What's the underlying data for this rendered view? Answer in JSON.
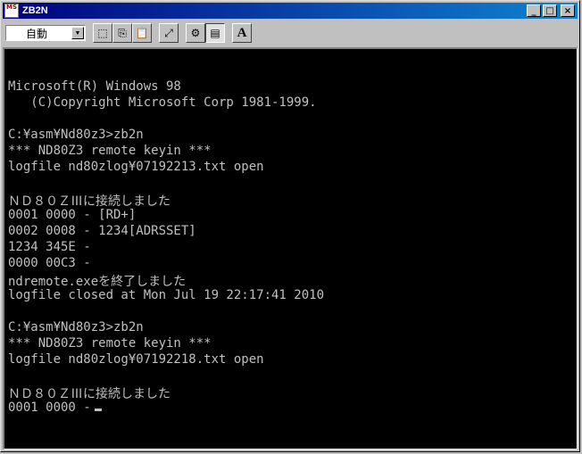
{
  "window": {
    "title": "ZB2N",
    "icon_text": "MS",
    "caption_buttons": {
      "minimize": "_",
      "maximize": "□",
      "close": "×"
    }
  },
  "toolbar": {
    "font_select": {
      "value": "自動"
    },
    "buttons": [
      {
        "name": "mark-icon",
        "glyph": "⬚"
      },
      {
        "name": "copy-icon",
        "glyph": "⎘"
      },
      {
        "name": "paste-icon",
        "glyph": "📋"
      },
      {
        "name": "fullscreen-icon",
        "glyph": "⤢"
      },
      {
        "name": "properties-icon",
        "glyph": "⚙"
      },
      {
        "name": "background-icon",
        "glyph": "▤"
      },
      {
        "name": "font-icon",
        "glyph": "A"
      }
    ]
  },
  "console": {
    "lines": [
      "",
      "Microsoft(R) Windows 98",
      "   (C)Copyright Microsoft Corp 1981-1999.",
      "",
      "C:¥asm¥Nd80z3>zb2n",
      "*** ND80Z3 remote keyin ***",
      "logfile nd80zlog¥07192213.txt open",
      "",
      "ＮＤ８０ＺⅢに接続しました",
      "0001 0000 - [RD+]",
      "0002 0008 - 1234[ADRSSET]",
      "1234 345E -",
      "0000 00C3 -",
      "ndremote.exeを終了しました",
      "logfile closed at Mon Jul 19 22:17:41 2010",
      "",
      "C:¥asm¥Nd80z3>zb2n",
      "*** ND80Z3 remote keyin ***",
      "logfile nd80zlog¥07192218.txt open",
      "",
      "ＮＤ８０ＺⅢに接続しました",
      "0001 0000 -"
    ]
  },
  "colors": {
    "titlebar": "#000080",
    "console_bg": "#000000",
    "console_fg": "#c0c0c0",
    "chrome": "#c0c0c0"
  }
}
